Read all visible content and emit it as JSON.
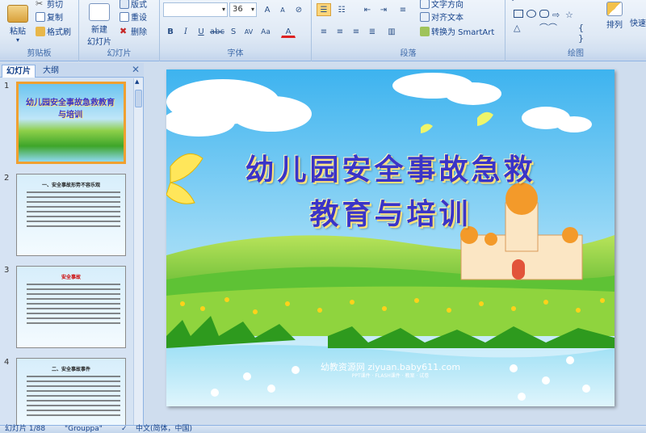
{
  "ribbon": {
    "clipboard": {
      "paste": "粘贴",
      "cut": "剪切",
      "copy": "复制",
      "format_painter": "格式刷",
      "label": "剪贴板"
    },
    "slides": {
      "new_slide_line1": "新建",
      "new_slide_line2": "幻灯片",
      "layout": "版式",
      "reset": "重设",
      "delete": "删除",
      "label": "幻灯片"
    },
    "font": {
      "size": "36",
      "label": "字体"
    },
    "paragraph": {
      "text_direction": "文字方向",
      "align_text": "对齐文本",
      "smartart": "转换为 SmartArt",
      "label": "段落"
    },
    "drawing": {
      "arrange": "排列",
      "quick_styles": "快速",
      "label": "绘图"
    }
  },
  "leftpane": {
    "tab_slides": "幻灯片",
    "tab_outline": "大纲",
    "close": "✕",
    "thumbnails": [
      {
        "num": "1",
        "title": "幼儿园安全事故急救教育与培训"
      },
      {
        "num": "2",
        "title": "一、安全事故形势不容乐观"
      },
      {
        "num": "3",
        "title": "安全事故"
      },
      {
        "num": "4",
        "title": "二、安全事故事件"
      }
    ]
  },
  "slide": {
    "title_line1": "幼儿园安全事故急救",
    "title_line2": "教育与培训",
    "watermark": "幼教资源网 ziyuan.baby611.com",
    "watermark_sub": "PPT课件 · FLASH课件 · 教案 · 试卷"
  },
  "status": {
    "slide_count": "幻灯片 1/88",
    "theme": "\"Grouppa\"",
    "language": "中文(简体，中国)"
  }
}
